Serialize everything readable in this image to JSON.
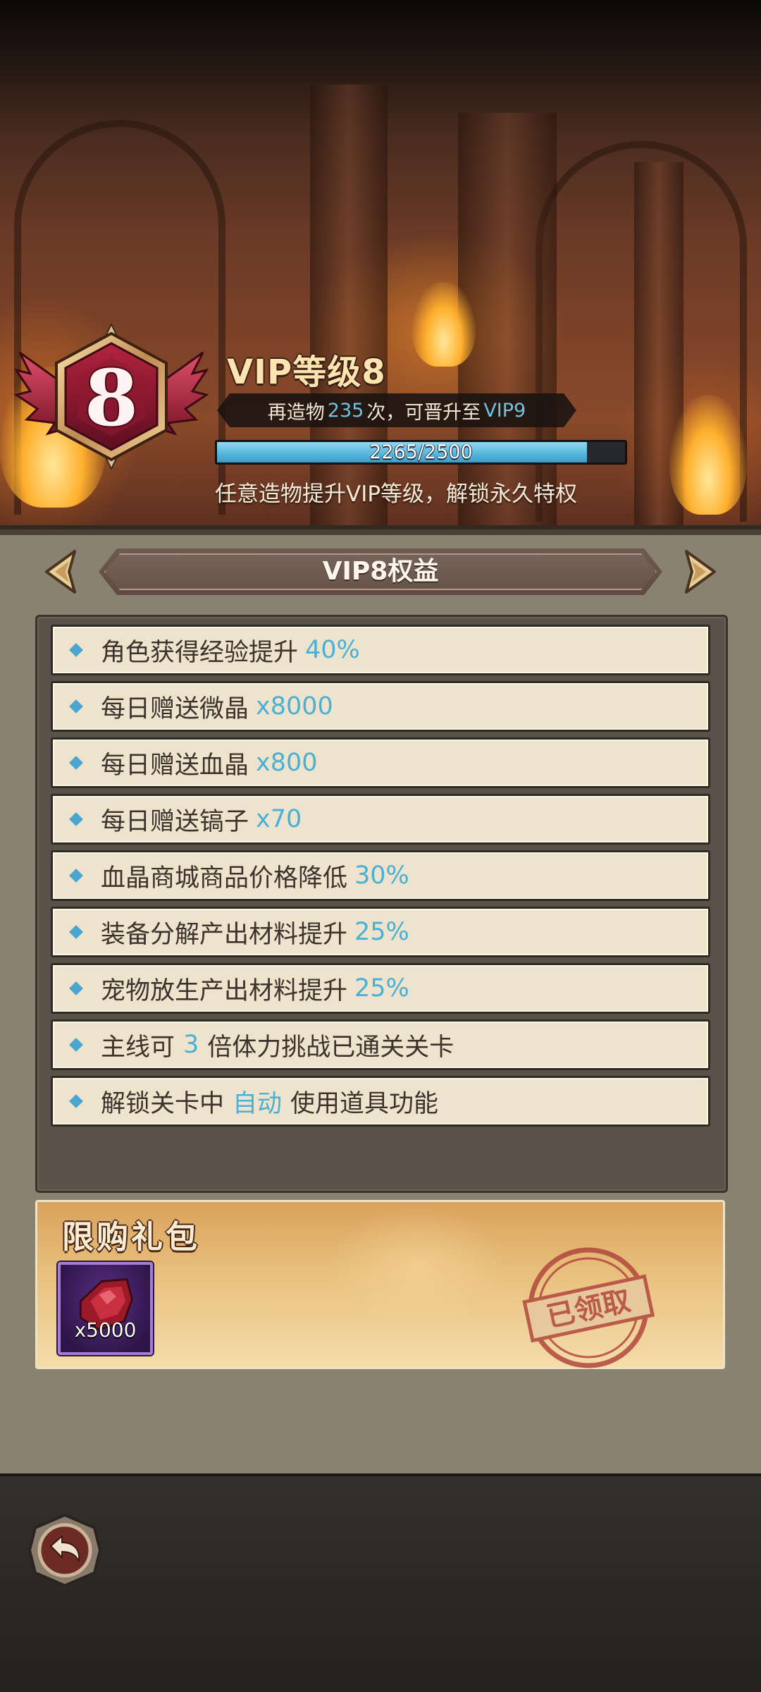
{
  "vip": {
    "level_title": "VIP等级8",
    "badge_number": "8",
    "upgrade": {
      "prefix": "再造物",
      "count": "235",
      "middle": "次，可晋升至",
      "next_level": "VIP9"
    },
    "progress": {
      "current": 2265,
      "max": 2500,
      "text": "2265/2500"
    },
    "hint": "任意造物提升VIP等级，解锁永久特权"
  },
  "benefits": {
    "title": "VIP8权益",
    "items": [
      {
        "text": "角色获得经验提升",
        "value": "40%",
        "suffix": ""
      },
      {
        "text": "每日赠送微晶",
        "value": "x8000",
        "suffix": ""
      },
      {
        "text": "每日赠送血晶",
        "value": "x800",
        "suffix": ""
      },
      {
        "text": "每日赠送镐子",
        "value": "x70",
        "suffix": ""
      },
      {
        "text": "血晶商城商品价格降低",
        "value": "30%",
        "suffix": ""
      },
      {
        "text": "装备分解产出材料提升",
        "value": "25%",
        "suffix": ""
      },
      {
        "text": "宠物放生产出材料提升",
        "value": "25%",
        "suffix": ""
      },
      {
        "text": "主线可",
        "value": "3",
        "suffix": "倍体力挑战已通关关卡"
      },
      {
        "text": "解锁关卡中",
        "value": "自动",
        "suffix": "使用道具功能"
      }
    ]
  },
  "gift": {
    "title": "限购礼包",
    "item_count": "x5000",
    "item_icon": "blood-crystal-icon",
    "stamp": "已领取"
  },
  "colors": {
    "highlight": "#4ab0d6",
    "progress_fill": "#56b5dc",
    "row_bg": "#eee3cd",
    "panel_bg": "#8a8270"
  }
}
